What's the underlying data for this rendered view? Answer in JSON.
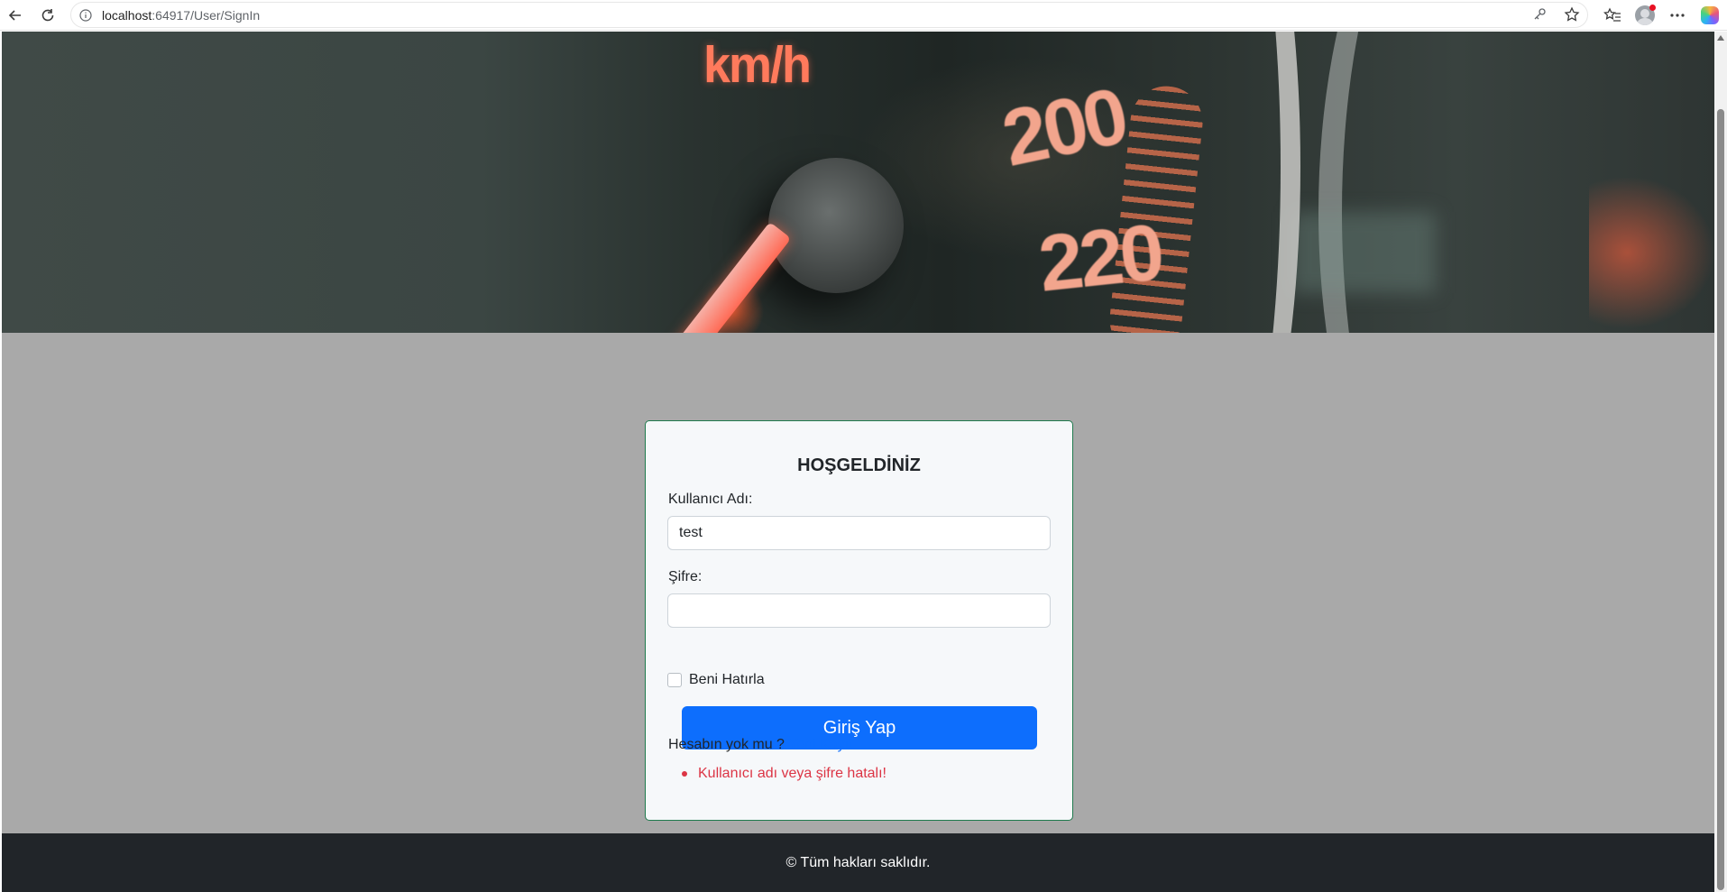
{
  "browser": {
    "url_host": "localhost",
    "url_path": ":64917/User/SignIn",
    "icons": [
      "back-icon",
      "refresh-icon",
      "info-icon",
      "key-icon",
      "star-icon",
      "favorites-icon",
      "profile-icon",
      "more-icon",
      "copilot-icon"
    ]
  },
  "hero": {
    "unit_text": "km/h",
    "speed_top": "200",
    "speed_bottom": "220"
  },
  "login": {
    "title": "HOŞGELDİNİZ",
    "username_label": "Kullanıcı Adı:",
    "username_value": "test",
    "password_label": "Şifre:",
    "password_value": "",
    "remember_label": "Beni Hatırla",
    "remember_checked": false,
    "submit_label": "Giriş Yap",
    "no_account_text": "Hesabın yok mu ?",
    "register_link": "Yeni Kayıt",
    "errors": [
      "Kullanıcı adı veya şifre hatalı!"
    ]
  },
  "footer": {
    "text": "© Tüm hakları saklıdır."
  },
  "colors": {
    "primary": "#0d6efd",
    "error": "#dc3545",
    "card_border": "#1f7a4d",
    "footer_bg": "#212529",
    "page_bg": "#a9a9a9"
  }
}
